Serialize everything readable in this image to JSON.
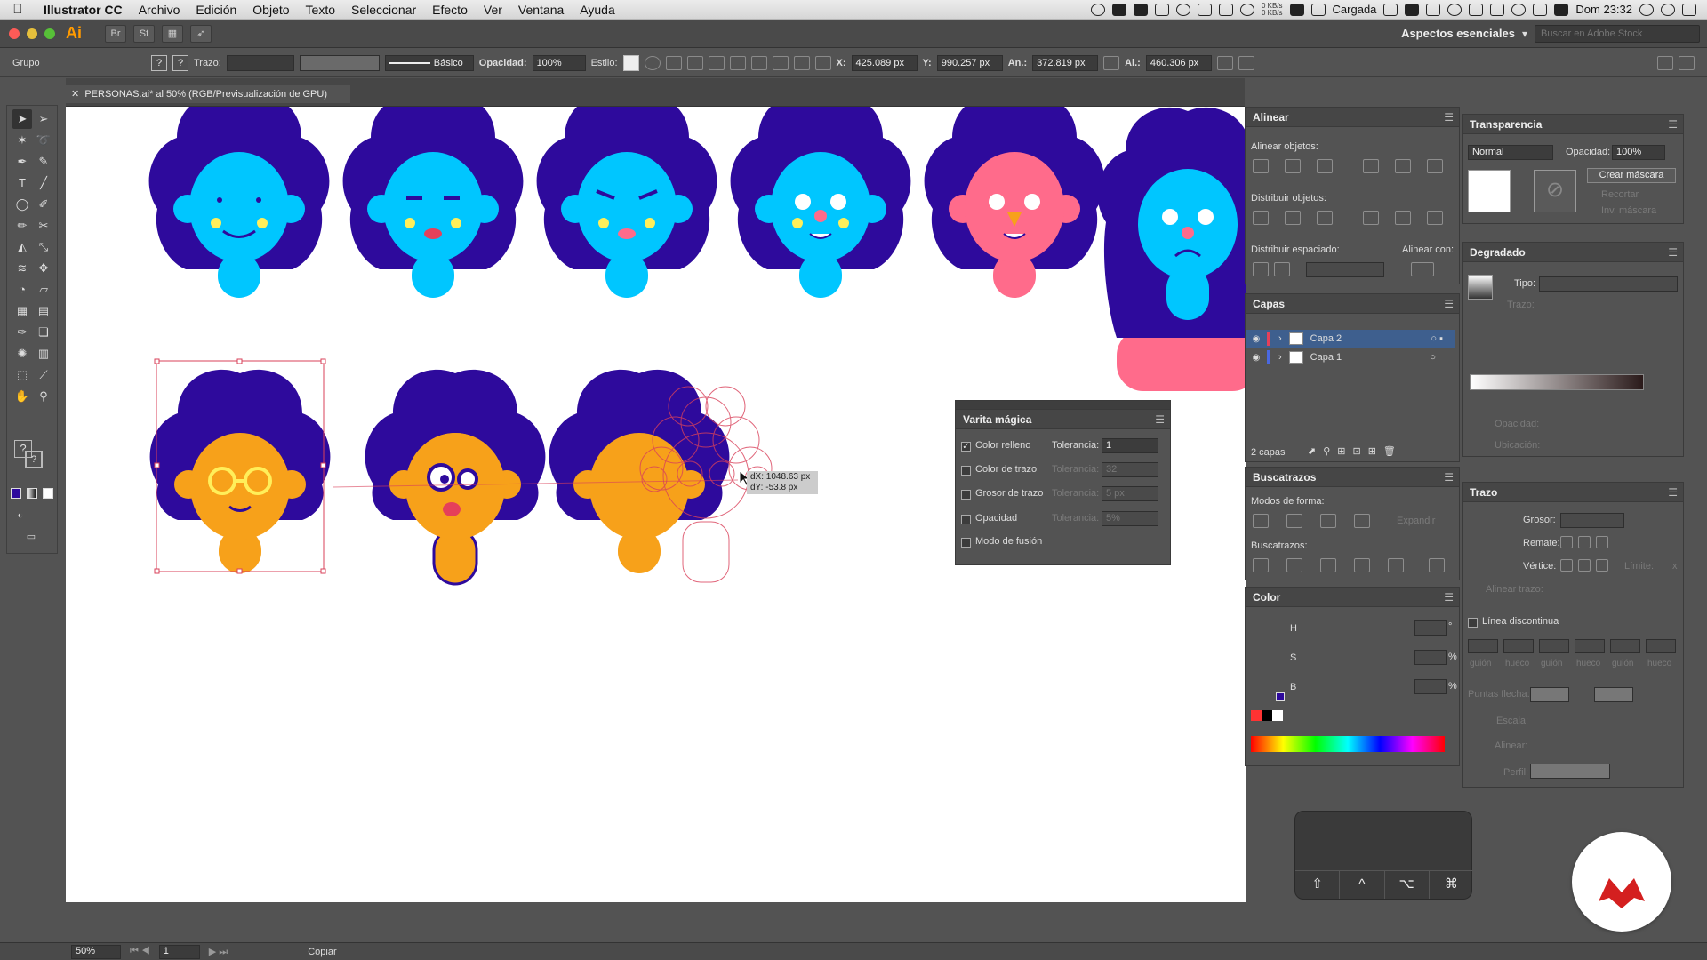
{
  "menubar": {
    "app": "Illustrator CC",
    "items": [
      "Archivo",
      "Edición",
      "Objeto",
      "Texto",
      "Seleccionar",
      "Efecto",
      "Ver",
      "Ventana",
      "Ayuda"
    ],
    "net_up": "0 KB/s",
    "net_down": "0 KB/s",
    "battery_label": "Cargada",
    "clock": "Dom 23:32"
  },
  "appbar": {
    "logo": "Ai",
    "st": "St",
    "workspace": "Aspectos esenciales",
    "search_placeholder": "Buscar en Adobe Stock"
  },
  "controlbar": {
    "selection": "Grupo",
    "stroke_label": "Trazo:",
    "brush_label": "Básico",
    "opacity_label": "Opacidad:",
    "opacity_value": "100%",
    "style_label": "Estilo:",
    "x_label": "X:",
    "x_value": "425.089 px",
    "y_label": "Y:",
    "y_value": "990.257 px",
    "w_label": "An.:",
    "w_value": "372.819 px",
    "h_label": "Al.:",
    "h_value": "460.306 px"
  },
  "document": {
    "tab_title": "PERSONAS.ai* al 50% (RGB/Previsualización de GPU)"
  },
  "canvas": {
    "drag_tooltip_dx": "dX: 1048.63 px",
    "drag_tooltip_dy": "dY: -53.8 px"
  },
  "align_panel": {
    "title": "Alinear",
    "align_objects": "Alinear objetos:",
    "distribute_objects": "Distribuir objetos:",
    "distribute_spacing": "Distribuir espaciado:",
    "align_to": "Alinear con:"
  },
  "layers_panel": {
    "title": "Capas",
    "layers": [
      {
        "name": "Capa 2",
        "color": "#e5405a",
        "selected": true
      },
      {
        "name": "Capa 1",
        "color": "#4a68e0",
        "selected": false
      }
    ],
    "count": "2 capas"
  },
  "magic_wand": {
    "title": "Varita mágica",
    "rows": [
      {
        "label": "Color relleno",
        "checked": true,
        "tolerance_label": "Tolerancia:",
        "tolerance": "1"
      },
      {
        "label": "Color de trazo",
        "checked": false,
        "tolerance_label": "Tolerancia:",
        "tolerance": "32"
      },
      {
        "label": "Grosor de trazo",
        "checked": false,
        "tolerance_label": "Tolerancia:",
        "tolerance": "5 px"
      },
      {
        "label": "Opacidad",
        "checked": false,
        "tolerance_label": "Tolerancia:",
        "tolerance": "5%"
      },
      {
        "label": "Modo de fusión",
        "checked": false
      }
    ]
  },
  "pathfinder": {
    "title": "Buscatrazos",
    "shape_modes": "Modos de forma:",
    "expand": "Expandir",
    "pathfinders": "Buscatrazos:"
  },
  "color_panel": {
    "title": "Color",
    "h": "H",
    "s": "S",
    "b": "B",
    "pct": "%",
    "deg": "°"
  },
  "transparency": {
    "title": "Transparencia",
    "mode": "Normal",
    "opacity_label": "Opacidad:",
    "opacity_value": "100%",
    "make_mask": "Crear máscara",
    "clip": "Recortar",
    "invert": "Inv. máscara"
  },
  "gradient": {
    "title": "Degradado",
    "type_label": "Tipo:",
    "stroke_label": "Trazo:",
    "opacity_label": "Opacidad:",
    "location_label": "Ubicación:"
  },
  "stroke_panel": {
    "title": "Trazo",
    "weight": "Grosor:",
    "cap": "Remate:",
    "corner": "Vértice:",
    "limit": "Límite:",
    "limit_x": "x",
    "align": "Alinear trazo:",
    "dashed": "Línea discontinua",
    "dash_labels": [
      "guión",
      "hueco",
      "guión",
      "hueco",
      "guión",
      "hueco"
    ],
    "arrowheads": "Puntas flecha:",
    "scale": "Escala:",
    "align2": "Alinear:",
    "profile": "Perfil:"
  },
  "statusbar": {
    "zoom": "50%",
    "artboard": "1",
    "status": "Copiar"
  },
  "key_overlay": [
    "⇧",
    "^",
    "⌥",
    "⌘"
  ],
  "colors": {
    "hair": "#2e0a9c",
    "face_blue": "#00c6ff",
    "face_pink": "#ff6b8b",
    "face_orange": "#f7a11a",
    "cheek": "#ffef5a",
    "selection": "#d9405a",
    "accent": "#ff9a00"
  }
}
